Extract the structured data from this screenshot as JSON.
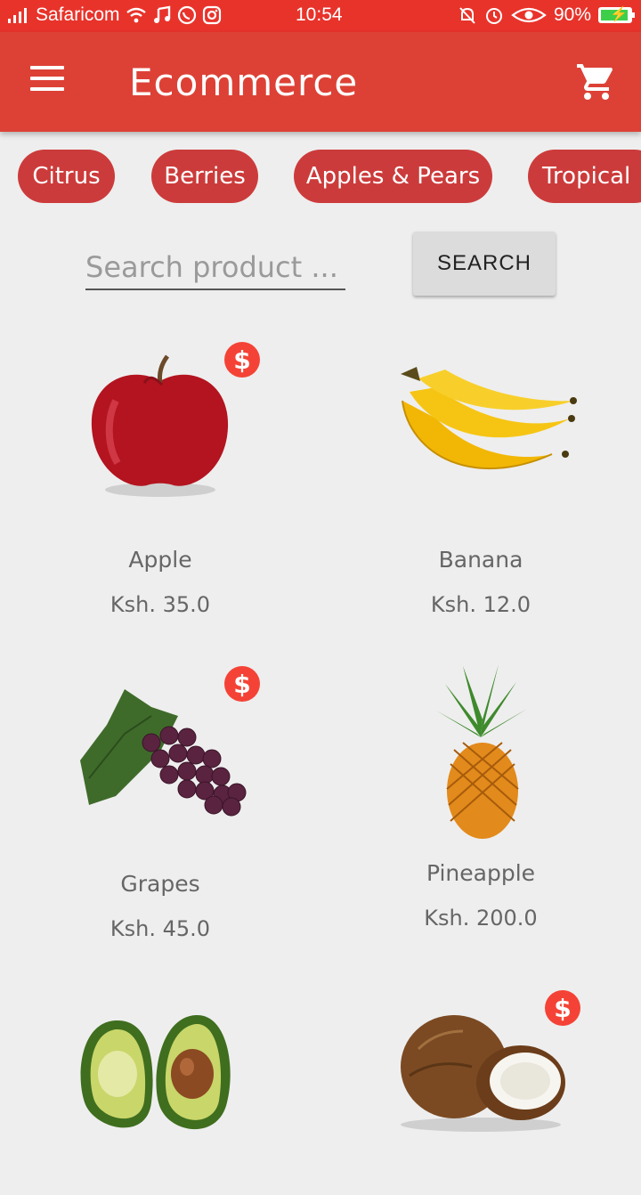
{
  "status_bar": {
    "carrier": "Safaricom",
    "time": "10:54",
    "battery": "90%"
  },
  "app_bar": {
    "title": "Ecommerce"
  },
  "categories": [
    {
      "label": "Citrus"
    },
    {
      "label": "Berries"
    },
    {
      "label": "Apples & Pears"
    },
    {
      "label": "Tropical"
    }
  ],
  "search": {
    "placeholder": "Search product ...",
    "button_label": "SEARCH"
  },
  "products": [
    {
      "name": "Apple",
      "price": "Ksh. 35.0",
      "on_sale": true,
      "badge": "$"
    },
    {
      "name": "Banana",
      "price": "Ksh. 12.0",
      "on_sale": false
    },
    {
      "name": "Grapes",
      "price": "Ksh. 45.0",
      "on_sale": true,
      "badge": "$"
    },
    {
      "name": "Pineapple",
      "price": "Ksh. 200.0",
      "on_sale": false
    },
    {
      "name": "",
      "price": "",
      "on_sale": false
    },
    {
      "name": "",
      "price": "",
      "on_sale": true,
      "badge": "$"
    }
  ],
  "colors": {
    "status_bar": "#e8332b",
    "app_bar": "#dd4136",
    "chip": "#cc3b3b",
    "badge": "#f44336",
    "background": "#eeeeee"
  }
}
